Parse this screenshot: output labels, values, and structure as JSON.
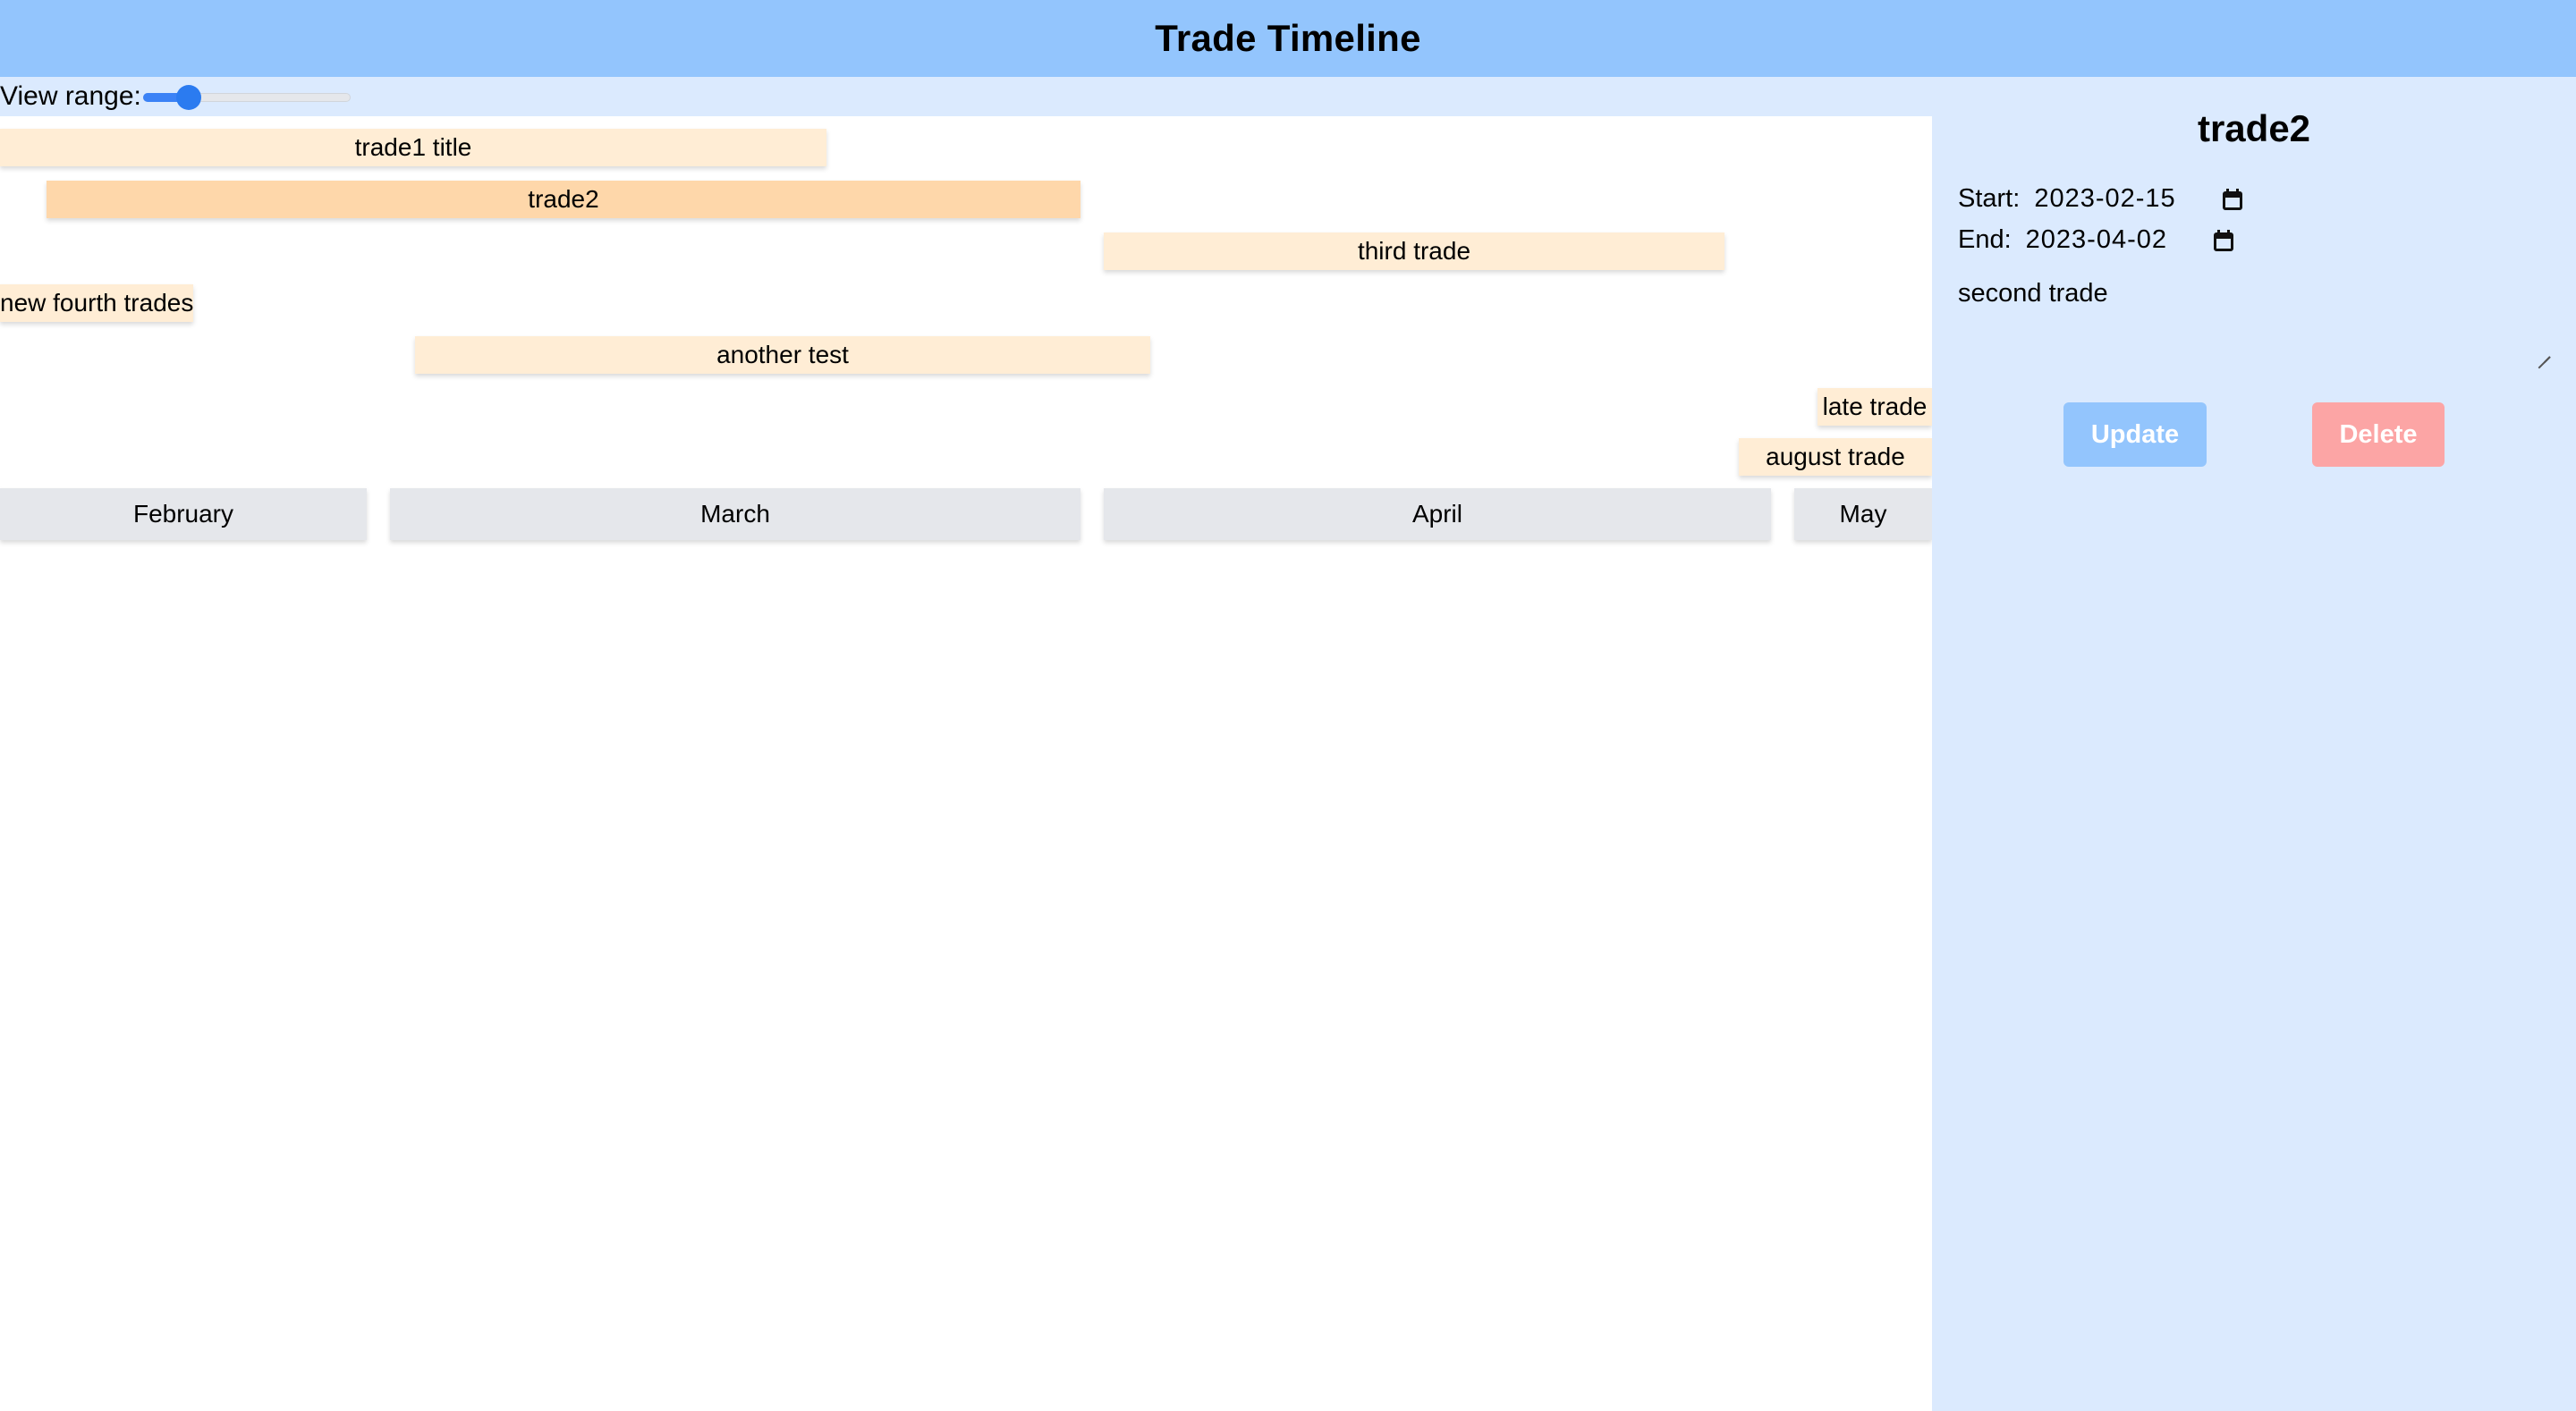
{
  "header": {
    "title": "Trade Timeline"
  },
  "controls": {
    "view_range_label": "View range:",
    "view_range_value": 0.22
  },
  "trades": [
    {
      "title": "trade1 title",
      "selected": false
    },
    {
      "title": "trade2",
      "selected": true
    },
    {
      "title": "third trade",
      "selected": false
    },
    {
      "title": "new fourth trades",
      "selected": false
    },
    {
      "title": "another test",
      "selected": false
    },
    {
      "title": "late trade",
      "selected": false
    },
    {
      "title": "august trade",
      "selected": false
    }
  ],
  "months": [
    "February",
    "March",
    "April",
    "May"
  ],
  "detail": {
    "title": "trade2",
    "start_label": "Start:",
    "start_value": "2023-02-15",
    "end_label": "End:",
    "end_value": "2023-04-02",
    "description": "second trade",
    "update_label": "Update",
    "delete_label": "Delete"
  },
  "colors": {
    "header": "#93c5fd",
    "panel": "#dbeafe",
    "bar": "#ffedd5",
    "bar_selected": "#fed7aa",
    "month": "#e5e7eb",
    "update": "#93c5fd",
    "delete": "#fca5a5"
  }
}
